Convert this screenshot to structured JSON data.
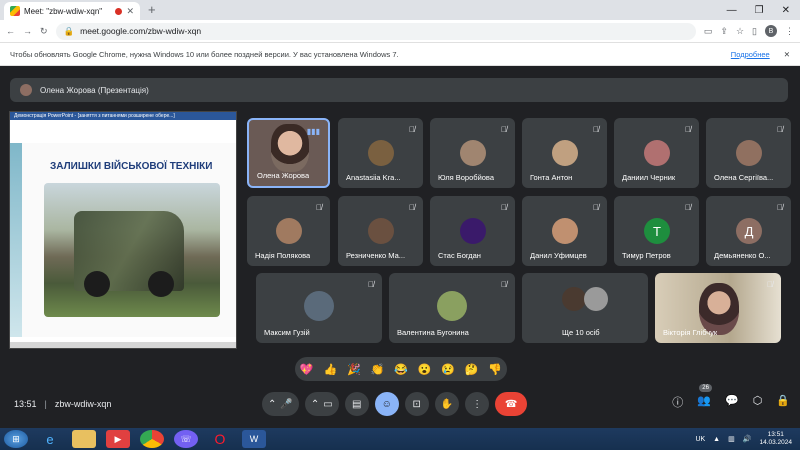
{
  "browser": {
    "tab_title": "Meet: \"zbw-wdiw-xqn\"",
    "new_tab": "+",
    "url": "meet.google.com/zbw-wdiw-xqn",
    "profile": "B"
  },
  "infobar": {
    "message": "Чтобы обновлять Google Chrome, нужна Windows 10 или более поздней версии. У вас установлена Windows 7.",
    "more": "Подробнее"
  },
  "presentation_bar": {
    "label": "Олена Жорова (Презентація)"
  },
  "presentation": {
    "window_title": "Демонстрація PowerPoint - [заняття з питаннями розширене обере...]",
    "slide_title": "ЗАЛИШКИ ВІЙСЬКОВОЇ ТЕХНІКИ"
  },
  "participants": [
    {
      "name": "Олена Жорова"
    },
    {
      "name": "Anastasiia Kra..."
    },
    {
      "name": "Юля Воробйова"
    },
    {
      "name": "Гонта Антон"
    },
    {
      "name": "Даниил Черник"
    },
    {
      "name": "Олена Сергіїва..."
    },
    {
      "name": "Надія Полякова"
    },
    {
      "name": "Резниченко Ма..."
    },
    {
      "name": "Стас Богдан"
    },
    {
      "name": "Данил Уфимцев"
    },
    {
      "name": "Тимур Петров",
      "initial": "Т"
    },
    {
      "name": "Демьяненко О...",
      "initial": "Д"
    },
    {
      "name": "Максим Гузій"
    },
    {
      "name": "Валентина Бугонина"
    },
    {
      "name": "Ще 10 осіб"
    },
    {
      "name": "Вікторія Глібчук"
    }
  ],
  "reactions": [
    "💖",
    "👍",
    "🎉",
    "👏",
    "😂",
    "😮",
    "😢",
    "🤔",
    "👎"
  ],
  "bottom": {
    "time": "13:51",
    "sep": "|",
    "code": "zbw-wdiw-xqn",
    "people_count": "26"
  },
  "taskbar": {
    "lang": "UK",
    "time": "13:51",
    "date": "14.03.2024"
  },
  "colors": {
    "bg": "#202124",
    "tile": "#3c4043",
    "accent": "#8ab4f8",
    "end_call": "#ea4335"
  }
}
